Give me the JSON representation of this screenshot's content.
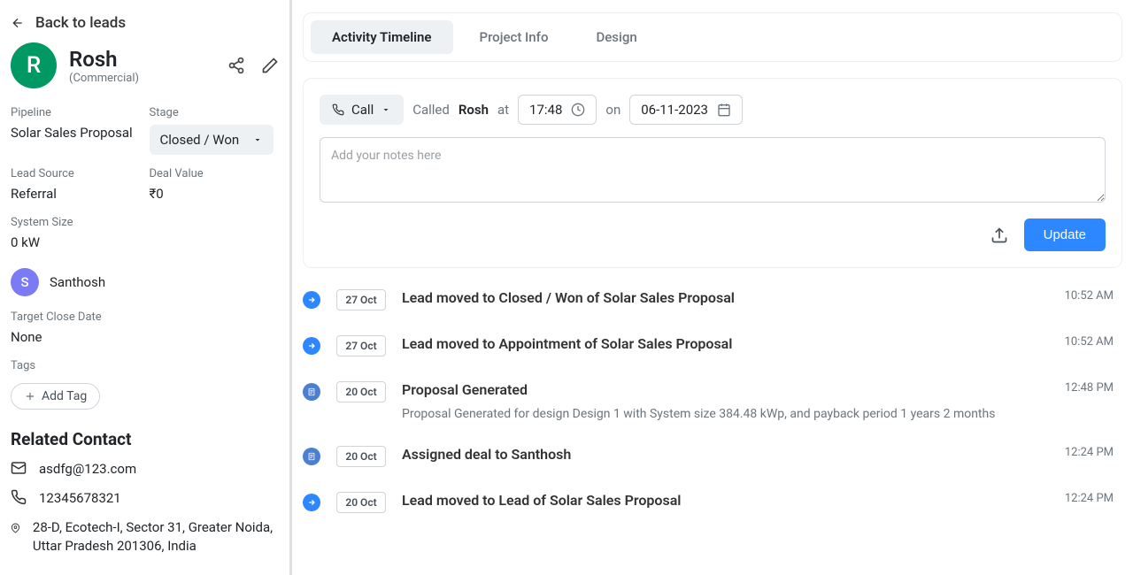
{
  "back": {
    "label": "Back to leads"
  },
  "lead": {
    "initial": "R",
    "name": "Rosh",
    "type": "(Commercial)",
    "pipeline_label": "Pipeline",
    "pipeline": "Solar Sales Proposal",
    "stage_label": "Stage",
    "stage": "Closed / Won",
    "lead_source_label": "Lead Source",
    "lead_source": "Referral",
    "deal_value_label": "Deal Value",
    "deal_value": "₹0",
    "system_size_label": "System Size",
    "system_size": "0 kW",
    "owner_initial": "S",
    "owner": "Santhosh",
    "target_close_label": "Target Close Date",
    "target_close": "None",
    "tags_label": "Tags",
    "add_tag": "Add Tag"
  },
  "contact": {
    "heading": "Related Contact",
    "email": "asdfg@123.com",
    "phone": "12345678321",
    "address": "28-D, Ecotech-I, Sector 31, Greater Noida, Uttar Pradesh 201306, India"
  },
  "tabs": {
    "activity": "Activity Timeline",
    "project": "Project Info",
    "design": "Design"
  },
  "composer": {
    "type": "Call",
    "called": "Called",
    "who": "Rosh",
    "at": "at",
    "time": "17:48",
    "on": "on",
    "date": "06-11-2023",
    "placeholder": "Add your notes here",
    "update": "Update"
  },
  "timeline": [
    {
      "icon": "arrow",
      "date": "27 Oct",
      "title": "Lead moved to Closed / Won of Solar Sales Proposal",
      "sub": "",
      "time": "10:52 AM"
    },
    {
      "icon": "arrow",
      "date": "27 Oct",
      "title": "Lead moved to Appointment of Solar Sales Proposal",
      "sub": "",
      "time": "10:52 AM"
    },
    {
      "icon": "doc",
      "date": "20 Oct",
      "title": "Proposal Generated",
      "sub": "Proposal Generated for design Design 1 with System size 384.48 kWp, and payback period 1 years 2 months",
      "time": "12:48 PM"
    },
    {
      "icon": "doc",
      "date": "20 Oct",
      "title": "Assigned deal to Santhosh",
      "sub": "",
      "time": "12:24 PM"
    },
    {
      "icon": "arrow",
      "date": "20 Oct",
      "title": "Lead moved to Lead of Solar Sales Proposal",
      "sub": "",
      "time": "12:24 PM"
    }
  ]
}
